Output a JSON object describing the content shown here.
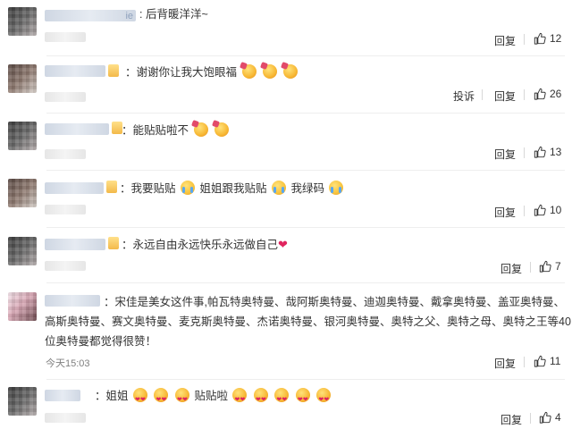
{
  "actions": {
    "reply": "回复",
    "report": "投诉"
  },
  "comments": [
    {
      "name_fragment": "ie",
      "text": ": 后背暖洋洋~",
      "likes": "12"
    },
    {
      "text_prefix": "：谢谢你让我大饱眼福",
      "likes": "26",
      "emoji_icons": [
        "party-face-icon",
        "party-face-icon",
        "party-face-icon"
      ]
    },
    {
      "text_prefix": "：能贴贴啦不",
      "likes": "13",
      "emoji_icons": [
        "party-face-icon",
        "party-face-icon"
      ]
    },
    {
      "text_a": "：我要贴贴",
      "text_b": "姐姐跟我贴贴",
      "text_c": "我绿码",
      "likes": "10",
      "emoji_icons": [
        "crying-face-icon",
        "crying-face-icon",
        "crying-face-icon"
      ]
    },
    {
      "text_prefix": "：永远自由永远快乐永远做自己",
      "heart": "❤",
      "likes": "7"
    },
    {
      "text": "：宋佳是美女这件事,帕瓦特奥特曼、哉阿斯奥特曼、迪迦奥特曼、戴拿奥特曼、盖亚奥特曼、高斯奥特曼、赛文奥特曼、麦克斯奥特曼、杰诺奥特曼、银河奥特曼、奥特之父、奥特之母、奥特之王等40位奥特曼都觉得很赞！",
      "timestamp": "今天15:03",
      "likes": "11"
    },
    {
      "text_a": "：姐姐",
      "text_b": "贴贴啦",
      "likes": "4",
      "emoji_icons": [
        "heart-eyes-icon",
        "heart-eyes-icon",
        "heart-eyes-icon",
        "heart-eyes-icon",
        "heart-eyes-icon",
        "heart-eyes-icon",
        "heart-eyes-icon",
        "heart-eyes-icon"
      ]
    }
  ],
  "colors": {
    "text": "#333333",
    "divider": "#eeeeee",
    "meta": "#808080",
    "heart": "#e0245e"
  }
}
